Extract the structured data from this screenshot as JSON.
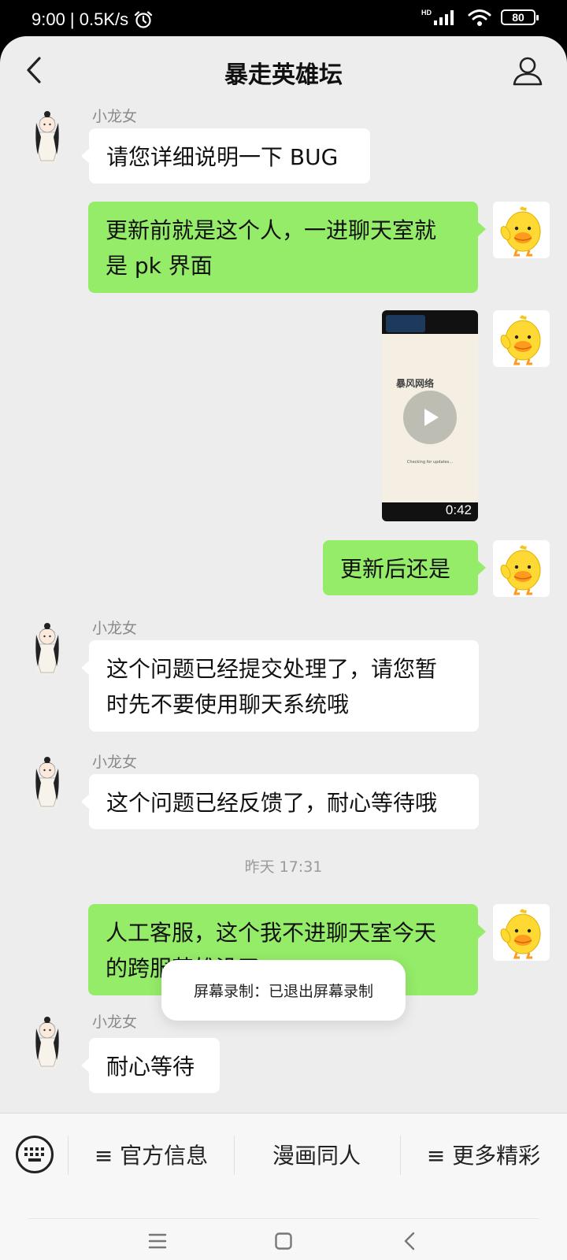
{
  "status_bar": {
    "time_speed": "9:00 | 0.5K/s",
    "network": "HD",
    "battery": "80"
  },
  "header": {
    "title": "暴走英雄坛"
  },
  "messages": [
    {
      "sender": "小龙女",
      "side": "in",
      "text": "请您详细说明一下 BUG"
    },
    {
      "side": "out",
      "line1": "更新前就是这个人，一进聊天室就",
      "line2": "是 pk 界面"
    },
    {
      "side": "out",
      "type": "video",
      "duration": "0:42",
      "overlay_text": "暴风网络",
      "status_text": "Checking for updates..."
    },
    {
      "side": "out",
      "text": "更新后还是"
    },
    {
      "sender": "小龙女",
      "side": "in",
      "line1": "这个问题已经提交处理了，请您暂",
      "line2": "时先不要使用聊天系统哦"
    },
    {
      "sender": "小龙女",
      "side": "in",
      "text": "这个问题已经反馈了，耐心等待哦"
    },
    {
      "side": "out",
      "line1": "人工客服，这个我不进聊天室今天",
      "line2": "的跨服英雄没了"
    },
    {
      "sender": "小龙女",
      "side": "in",
      "text": "耐心等待"
    }
  ],
  "timestamp": "昨天 17:31",
  "toast": "屏幕录制：已退出屏幕录制",
  "bottom_menu": [
    {
      "label": "≡ 官方信息"
    },
    {
      "label": "漫画同人"
    },
    {
      "label": "≡ 更多精彩"
    }
  ],
  "colors": {
    "outgoing_bubble": "#95ec69",
    "incoming_bubble": "#ffffff",
    "chat_background": "#ededed"
  }
}
